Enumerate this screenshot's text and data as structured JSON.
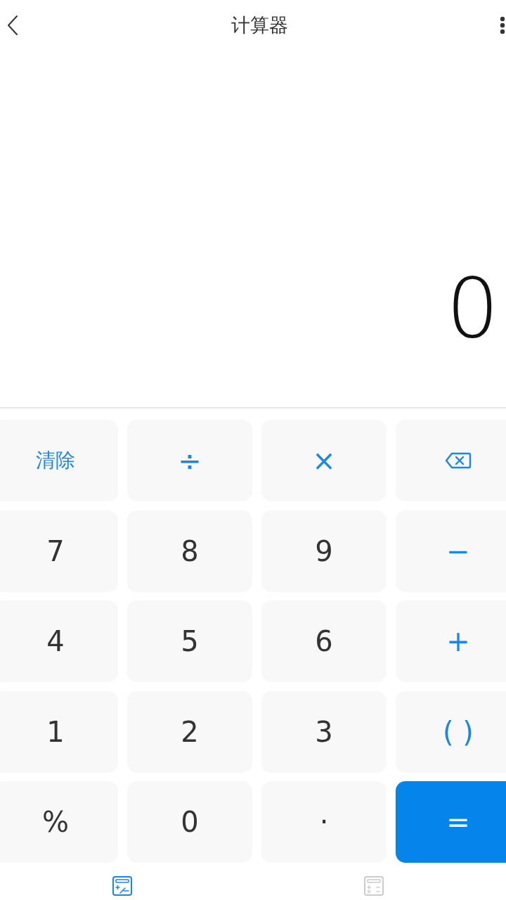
{
  "header": {
    "title": "计算器"
  },
  "display": {
    "value": "0"
  },
  "keys": [
    {
      "kind": "action",
      "label": "清除"
    },
    {
      "kind": "operator",
      "label": "÷"
    },
    {
      "kind": "operator",
      "label": "×"
    },
    {
      "kind": "backspace"
    },
    {
      "kind": "number",
      "label": "7"
    },
    {
      "kind": "number",
      "label": "8"
    },
    {
      "kind": "number",
      "label": "9"
    },
    {
      "kind": "operator",
      "label": "−"
    },
    {
      "kind": "number",
      "label": "4"
    },
    {
      "kind": "number",
      "label": "5"
    },
    {
      "kind": "number",
      "label": "6"
    },
    {
      "kind": "operator",
      "label": "+"
    },
    {
      "kind": "number",
      "label": "1"
    },
    {
      "kind": "number",
      "label": "2"
    },
    {
      "kind": "number",
      "label": "3"
    },
    {
      "kind": "operator",
      "label": "( )"
    },
    {
      "kind": "number",
      "label": "%"
    },
    {
      "kind": "number",
      "label": "0"
    },
    {
      "kind": "number",
      "label": "·"
    },
    {
      "kind": "equals",
      "label": "="
    }
  ],
  "tabs": [
    {
      "kind": "plus-minus",
      "selected": true
    },
    {
      "kind": "operators",
      "selected": false
    }
  ]
}
